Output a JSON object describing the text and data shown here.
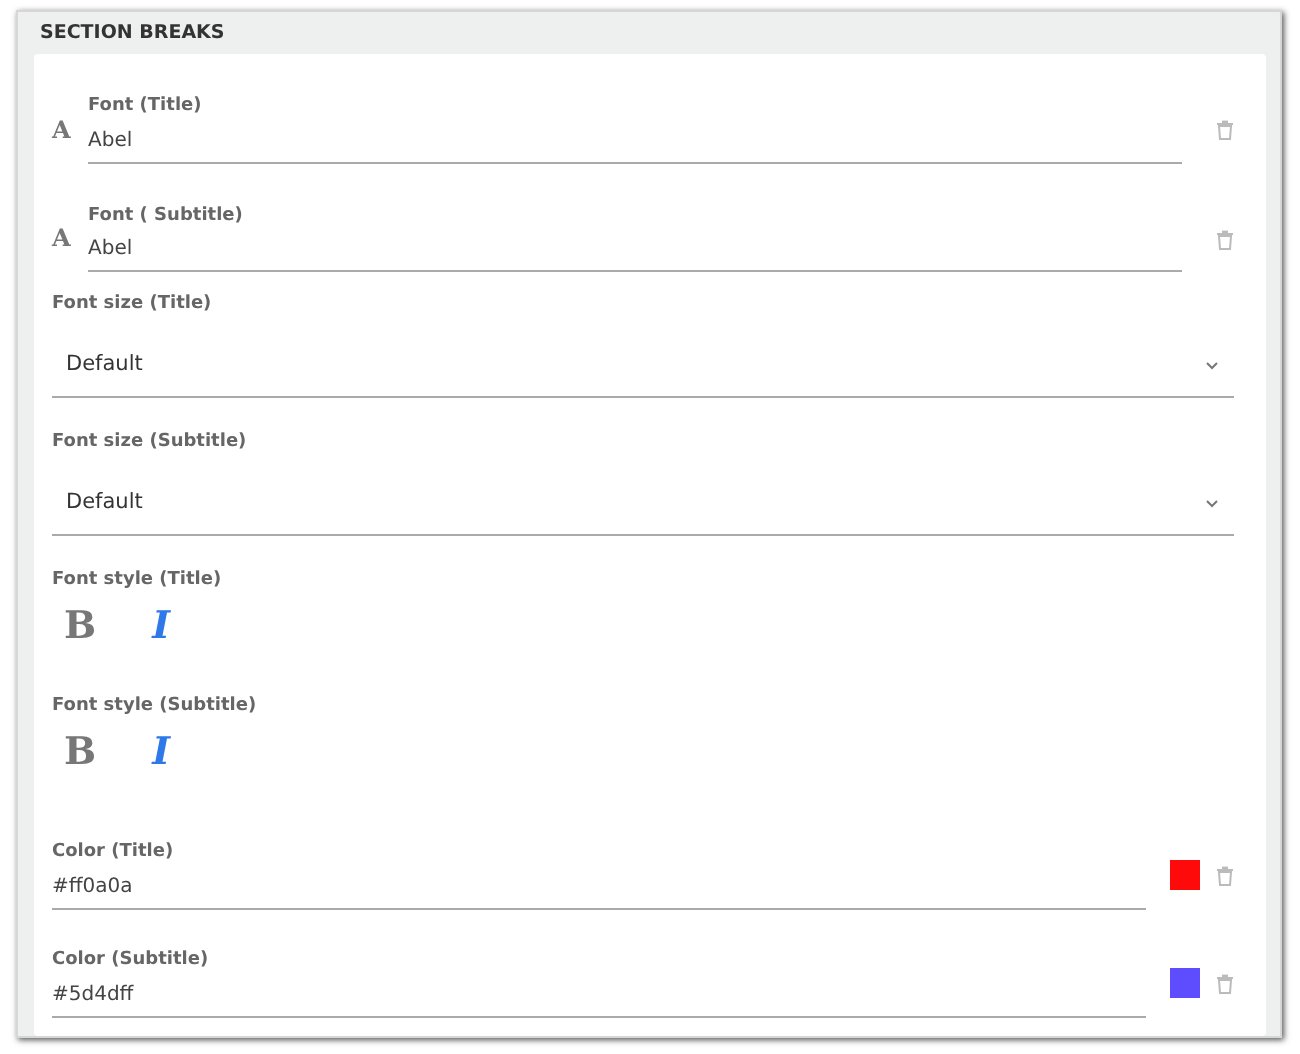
{
  "section": {
    "title": "SECTION BREAKS"
  },
  "fields": [
    {
      "kind": "font",
      "label": "Font (Title)",
      "value": "Abel",
      "icon": "A"
    },
    {
      "kind": "font",
      "label": "Font ( Subtitle)",
      "value": "Abel",
      "icon": "A"
    },
    {
      "kind": "select",
      "label": "Font size (Title)",
      "value": "Default"
    },
    {
      "kind": "select",
      "label": "Font size (Subtitle)",
      "value": "Default"
    },
    {
      "kind": "style",
      "label": "Font style (Title)",
      "bold": {
        "text": "B",
        "selected": false
      },
      "italic": {
        "text": "I",
        "selected": true
      }
    },
    {
      "kind": "style",
      "label": "Font style (Subtitle)",
      "bold": {
        "text": "B",
        "selected": false
      },
      "italic": {
        "text": "I",
        "selected": true
      }
    },
    {
      "kind": "color",
      "label": "Color (Title)",
      "value": "#ff0a0a",
      "color": "#ff0a0a"
    },
    {
      "kind": "color",
      "label": "Color (Subtitle)",
      "value": "#5d4dff",
      "color": "#5d4dff"
    }
  ]
}
